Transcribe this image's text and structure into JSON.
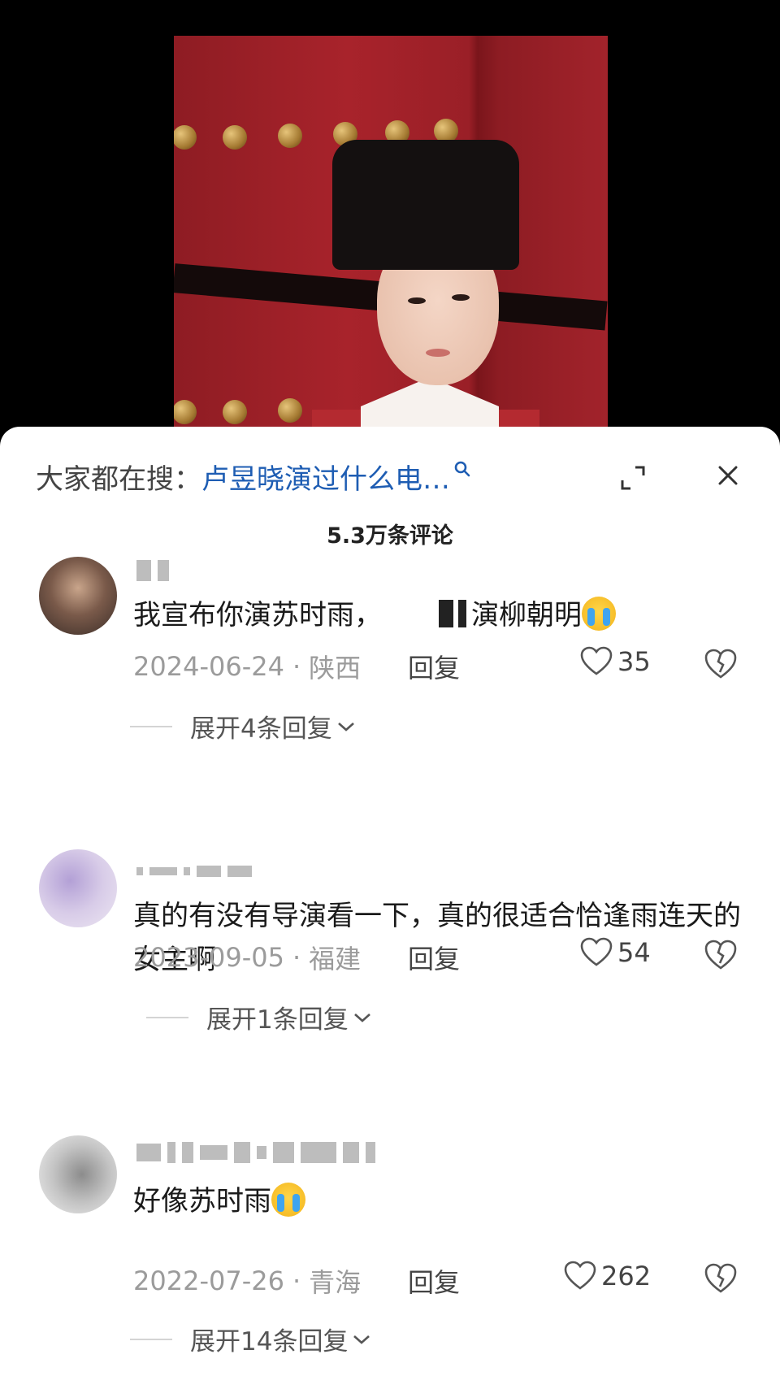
{
  "search": {
    "prefix": "大家都在搜：",
    "query": "卢昱晓演过什么电…"
  },
  "comments_count": "5.3万条评论",
  "comments": [
    {
      "text_before": "我宣布你演苏时雨，",
      "text_after": "演柳朝明",
      "date": "2024-06-24",
      "location": "陕西",
      "reply_label": "回复",
      "likes": "35",
      "expand_label": "展开4条回复"
    },
    {
      "text": "真的有没有导演看一下，真的很适合恰逢雨连天的女主啊",
      "date": "2023-09-05",
      "location": "福建",
      "reply_label": "回复",
      "likes": "54",
      "expand_label": "展开1条回复"
    },
    {
      "text_before": "好像苏时雨",
      "date": "2022-07-26",
      "location": "青海",
      "reply_label": "回复",
      "likes": "262",
      "expand_label": "展开14条回复"
    }
  ],
  "icons": [
    "search-icon",
    "expand-icon",
    "close-icon",
    "heart-icon",
    "broken-heart-icon",
    "chevron-down-icon",
    "crying-emoji-icon"
  ]
}
